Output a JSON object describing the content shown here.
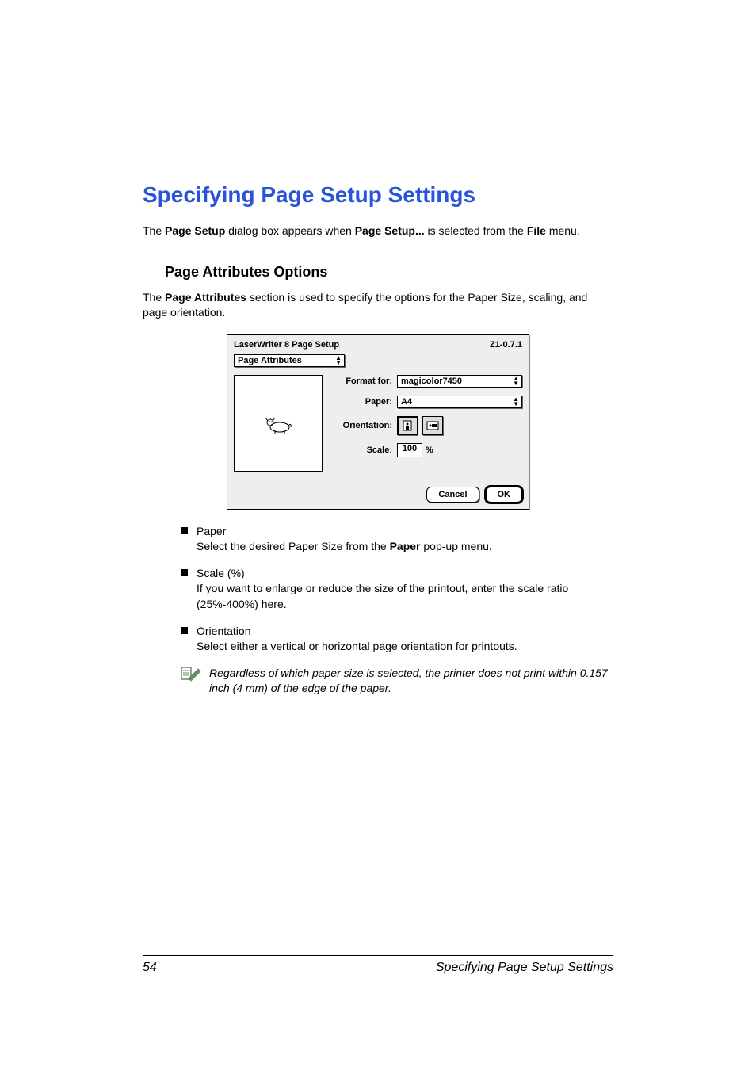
{
  "title": "Specifying Page Setup Settings",
  "intro": {
    "full": "The Page Setup dialog box appears when Page Setup... is selected from the File menu."
  },
  "section": {
    "heading": "Page Attributes Options",
    "desc": "The Page Attributes section is used to specify the options for the Paper Size, scaling, and page orientation."
  },
  "dialog": {
    "title": "LaserWriter 8 Page Setup",
    "version": "Z1-0.7.1",
    "tab": "Page Attributes",
    "format_for_label": "Format for:",
    "format_for_value": "magicolor7450",
    "paper_label": "Paper:",
    "paper_value": "A4",
    "orientation_label": "Orientation:",
    "scale_label": "Scale:",
    "scale_value": "100",
    "scale_unit": "%",
    "cancel": "Cancel",
    "ok": "OK"
  },
  "bullets": [
    {
      "title": "Paper",
      "text": "Select the desired Paper Size from the Paper pop-up menu."
    },
    {
      "title": "Scale (%)",
      "text": "If you want to enlarge or reduce the size of the printout, enter the scale ratio (25%-400%) here."
    },
    {
      "title": "Orientation",
      "text": "Select either a vertical or horizontal page orientation for printouts."
    }
  ],
  "note": "Regardless of which paper size is selected, the printer does not print within 0.157 inch (4 mm) of the edge of the paper.",
  "footer": {
    "page": "54",
    "title": "Specifying Page Setup Settings"
  }
}
